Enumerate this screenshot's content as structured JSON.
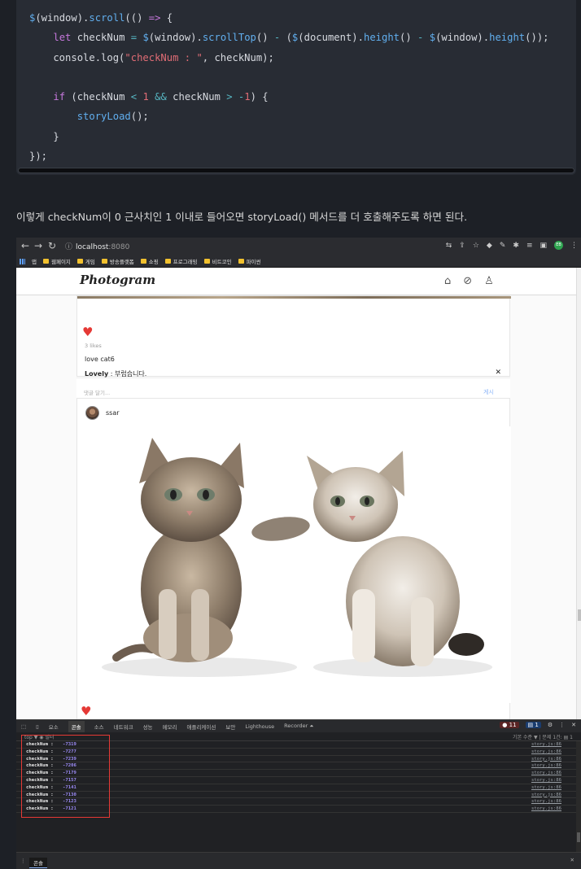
{
  "code": {
    "lines": [
      [
        {
          "t": "$",
          "c": "tk-fn"
        },
        {
          "t": "(window)."
        },
        {
          "t": "scroll",
          "c": "tk-fn"
        },
        {
          "t": "(() "
        },
        {
          "t": "=>",
          "c": "tk-kw"
        },
        {
          "t": " {"
        }
      ],
      [
        {
          "t": "    "
        },
        {
          "t": "let",
          "c": "tk-kw"
        },
        {
          "t": " checkNum "
        },
        {
          "t": "=",
          "c": "tk-op"
        },
        {
          "t": " "
        },
        {
          "t": "$",
          "c": "tk-fn"
        },
        {
          "t": "(window)."
        },
        {
          "t": "scrollTop",
          "c": "tk-fn"
        },
        {
          "t": "() "
        },
        {
          "t": "-",
          "c": "tk-op"
        },
        {
          "t": " ("
        },
        {
          "t": "$",
          "c": "tk-fn"
        },
        {
          "t": "(document)."
        },
        {
          "t": "height",
          "c": "tk-fn"
        },
        {
          "t": "() "
        },
        {
          "t": "-",
          "c": "tk-op"
        },
        {
          "t": " "
        },
        {
          "t": "$",
          "c": "tk-fn"
        },
        {
          "t": "(window)."
        },
        {
          "t": "height",
          "c": "tk-fn"
        },
        {
          "t": "());"
        }
      ],
      [
        {
          "t": "    console.log("
        },
        {
          "t": "\"checkNum : \"",
          "c": "tk-str"
        },
        {
          "t": ", checkNum);"
        }
      ],
      [
        {
          "t": ""
        }
      ],
      [
        {
          "t": "    "
        },
        {
          "t": "if",
          "c": "tk-kw"
        },
        {
          "t": " (checkNum "
        },
        {
          "t": "<",
          "c": "tk-op"
        },
        {
          "t": " "
        },
        {
          "t": "1",
          "c": "tk-num"
        },
        {
          "t": " "
        },
        {
          "t": "&&",
          "c": "tk-op"
        },
        {
          "t": " checkNum "
        },
        {
          "t": ">",
          "c": "tk-op"
        },
        {
          "t": " "
        },
        {
          "t": "-",
          "c": "tk-op"
        },
        {
          "t": "1",
          "c": "tk-num"
        },
        {
          "t": ") {"
        }
      ],
      [
        {
          "t": "        "
        },
        {
          "t": "storyLoad",
          "c": "tk-fn"
        },
        {
          "t": "();"
        }
      ],
      [
        {
          "t": "    }"
        }
      ],
      [
        {
          "t": "});"
        }
      ]
    ]
  },
  "description": "이렇게 checkNum이 0 근사치인 1 이내로 들어오면 storyLoad() 메서드를 더 호출해주도록 하면 된다.",
  "browser": {
    "url_host": "localhost",
    "url_port": ":8080",
    "bookmarks": [
      "앱",
      "웹페이지",
      "게임",
      "방송플랫폼",
      "쇼핑",
      "프로그래밍",
      "비트코인",
      "파이썬"
    ]
  },
  "site": {
    "logo": "Photogram",
    "post1": {
      "likes": "3 likes",
      "caption": "love cat6",
      "comment_user": "Lovely",
      "comment_text": " : 부럽습니다.",
      "comment_placeholder": "댓글 달기...",
      "post_button": "게시"
    },
    "post2": {
      "username": "ssar"
    }
  },
  "devtools": {
    "tabs": [
      "요소",
      "콘솔",
      "소스",
      "네트워크",
      "성능",
      "메모리",
      "애플리케이션",
      "보안",
      "Lighthouse",
      "Recorder ⏶"
    ],
    "active_tab": "콘솔",
    "errors": "● 11",
    "messages": "▤ 1",
    "filter_left": "top ▼   ◉   필터",
    "filter_right": "기본 수준 ▼   |   문제 1건: ▤ 1",
    "log_label": "checkNum :",
    "log_source": "story.js:86",
    "log_values": [
      "-7319",
      "-7277",
      "-7239",
      "-7206",
      "-7179",
      "-7157",
      "-7141",
      "-7130",
      "-7123",
      "-7121"
    ],
    "drawer_tab": "콘솔"
  },
  "colors": {
    "heart": "#e53935",
    "highlight": "#e53935",
    "log_value": "#9d8cf7"
  }
}
